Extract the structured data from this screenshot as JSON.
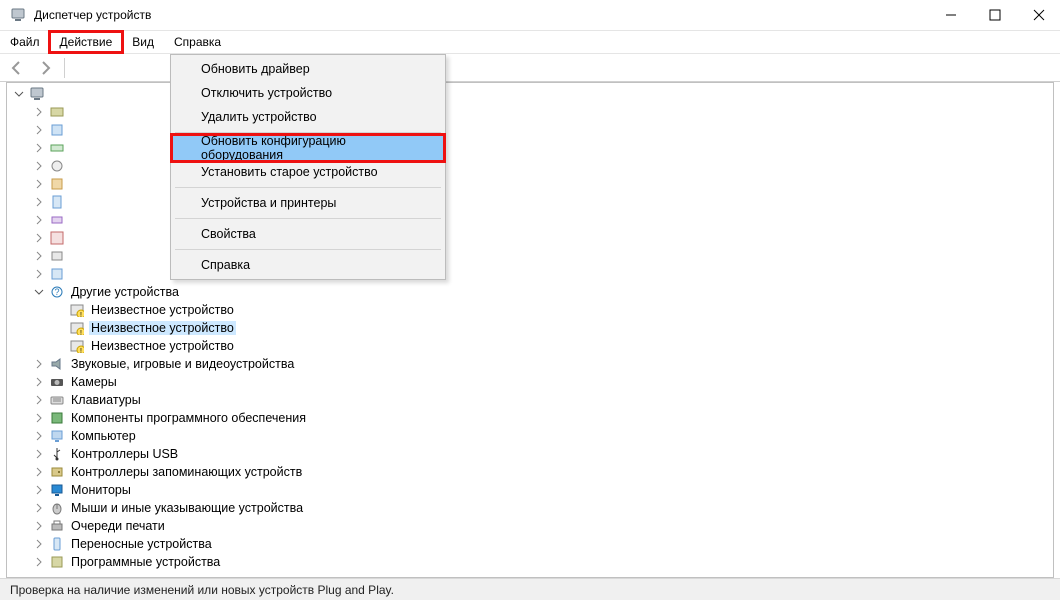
{
  "window": {
    "title": "Диспетчер устройств"
  },
  "menubar": {
    "file": "Файл",
    "action": "Действие",
    "view": "Вид",
    "help": "Справка"
  },
  "dropdown": {
    "update_driver": "Обновить драйвер",
    "disable_device": "Отключить устройство",
    "delete_device": "Удалить устройство",
    "refresh_hw": "Обновить конфигурацию оборудования",
    "install_legacy": "Установить старое устройство",
    "devices_printers": "Устройства и принтеры",
    "properties": "Свойства",
    "help": "Справка"
  },
  "tree": {
    "other_devices": "Другие устройства",
    "unknown1": "Неизвестное устройство",
    "unknown2": "Неизвестное устройство",
    "unknown3": "Неизвестное устройство",
    "audio": "Звуковые, игровые и видеоустройства",
    "cameras": "Камеры",
    "keyboards": "Клавиатуры",
    "software_components": "Компоненты программного обеспечения",
    "computer": "Компьютер",
    "usb_controllers": "Контроллеры USB",
    "storage_controllers": "Контроллеры запоминающих устройств",
    "monitors": "Мониторы",
    "mice": "Мыши и иные указывающие устройства",
    "print_queues": "Очереди печати",
    "portable_devices": "Переносные устройства",
    "software_devices": "Программные устройства"
  },
  "statusbar": {
    "text": "Проверка на наличие изменений или новых устройств Plug and Play."
  }
}
